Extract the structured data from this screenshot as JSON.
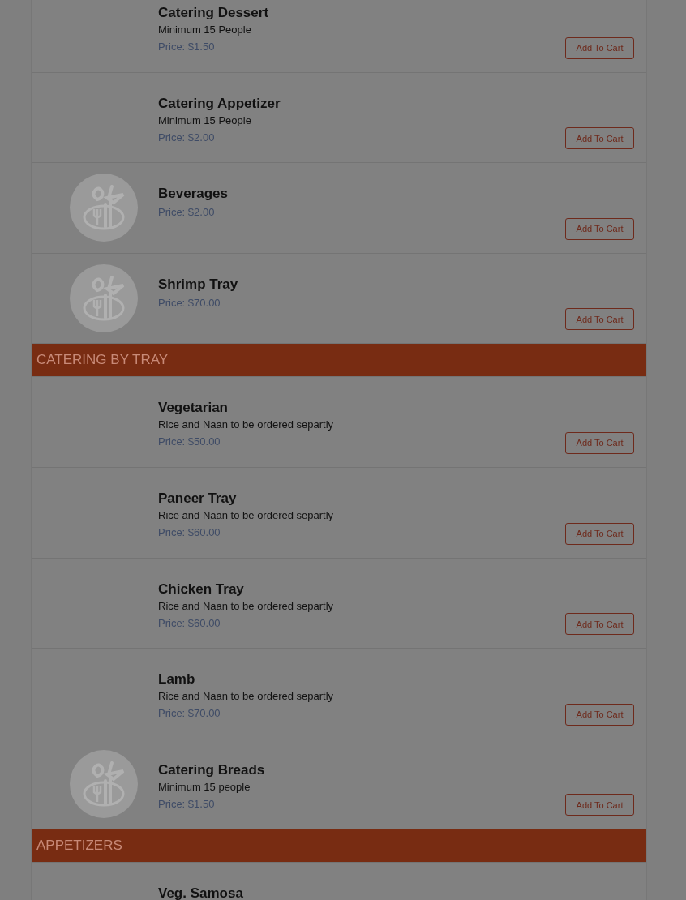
{
  "menu": [
    {
      "kind": "item",
      "name": "Catering Dessert",
      "description": "Minimum 15 People",
      "price": "Price: $1.50",
      "image": false,
      "button": "Add To Cart"
    },
    {
      "kind": "item",
      "name": "Catering Appetizer",
      "description": "Minimum 15 People",
      "price": "Price: $2.00",
      "image": false,
      "button": "Add To Cart"
    },
    {
      "kind": "item",
      "name": "Beverages",
      "price": "Price: $2.00",
      "image": true,
      "button": "Add To Cart"
    },
    {
      "kind": "item",
      "name": "Shrimp Tray",
      "price": "Price: $70.00",
      "image": true,
      "button": "Add To Cart"
    },
    {
      "kind": "section",
      "title": "CATERING BY TRAY"
    },
    {
      "kind": "item",
      "name": "Vegetarian",
      "description": "Rice and Naan to be ordered separtly",
      "price": "Price: $50.00",
      "image": false,
      "button": "Add To Cart"
    },
    {
      "kind": "item",
      "name": "Paneer Tray",
      "description": "Rice and Naan to be ordered separtly",
      "price": "Price: $60.00",
      "image": false,
      "button": "Add To Cart"
    },
    {
      "kind": "item",
      "name": "Chicken Tray",
      "description": "Rice and Naan to be ordered separtly",
      "price": "Price: $60.00",
      "image": false,
      "button": "Add To Cart"
    },
    {
      "kind": "item",
      "name": "Lamb",
      "description": "Rice and Naan to be ordered separtly",
      "price": "Price: $70.00",
      "image": false,
      "button": "Add To Cart"
    },
    {
      "kind": "item",
      "name": "Catering Breads",
      "description": "Minimum 15 people",
      "price": "Price: $1.50",
      "image": true,
      "button": "Add To Cart"
    },
    {
      "kind": "section",
      "title": "APPETIZERS"
    },
    {
      "kind": "item",
      "name": "Veg. Samosa"
    }
  ]
}
